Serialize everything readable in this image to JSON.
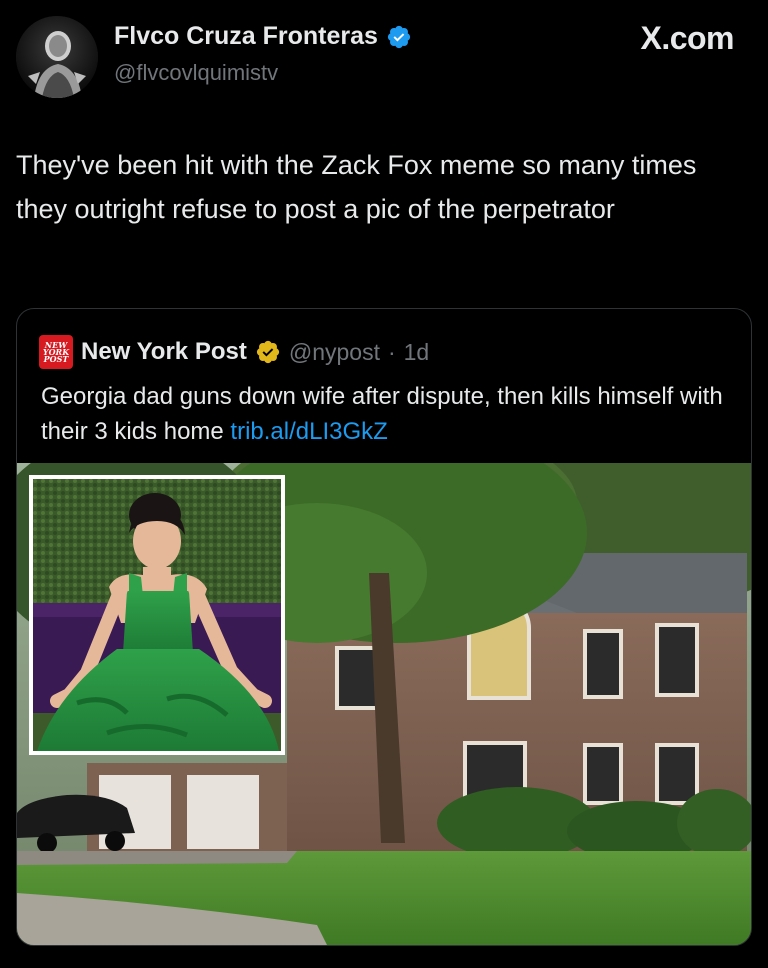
{
  "tweet": {
    "author_name": "Flvco Cruza Fronteras",
    "author_handle": "@flvcovlquimistv",
    "platform": "X.com",
    "text": "They've been hit with the Zack Fox meme so many times they outright refuse to post a pic of the perpetrator"
  },
  "quoted": {
    "author_name": "New York Post",
    "handle": "@nypost",
    "separator": "·",
    "time": "1d",
    "logo_text": [
      "NEW",
      "YORK",
      "POST"
    ],
    "text": "Georgia dad guns down wife after dispute, then kills himself with their 3 kids home ",
    "link_text": "trib.al/dLI3GkZ"
  },
  "colors": {
    "background": "#000000",
    "text_primary": "#e7e9ea",
    "text_secondary": "#71767b",
    "link": "#1d9bf0",
    "verified_blue": "#1d9bf0",
    "verified_gold": "#e2b719",
    "nypost_red": "#d71920"
  },
  "icons": {
    "author_verified": "verified-badge-icon",
    "quoted_verified": "gold-verified-badge-icon",
    "quoted_logo": "new-york-post-logo"
  }
}
